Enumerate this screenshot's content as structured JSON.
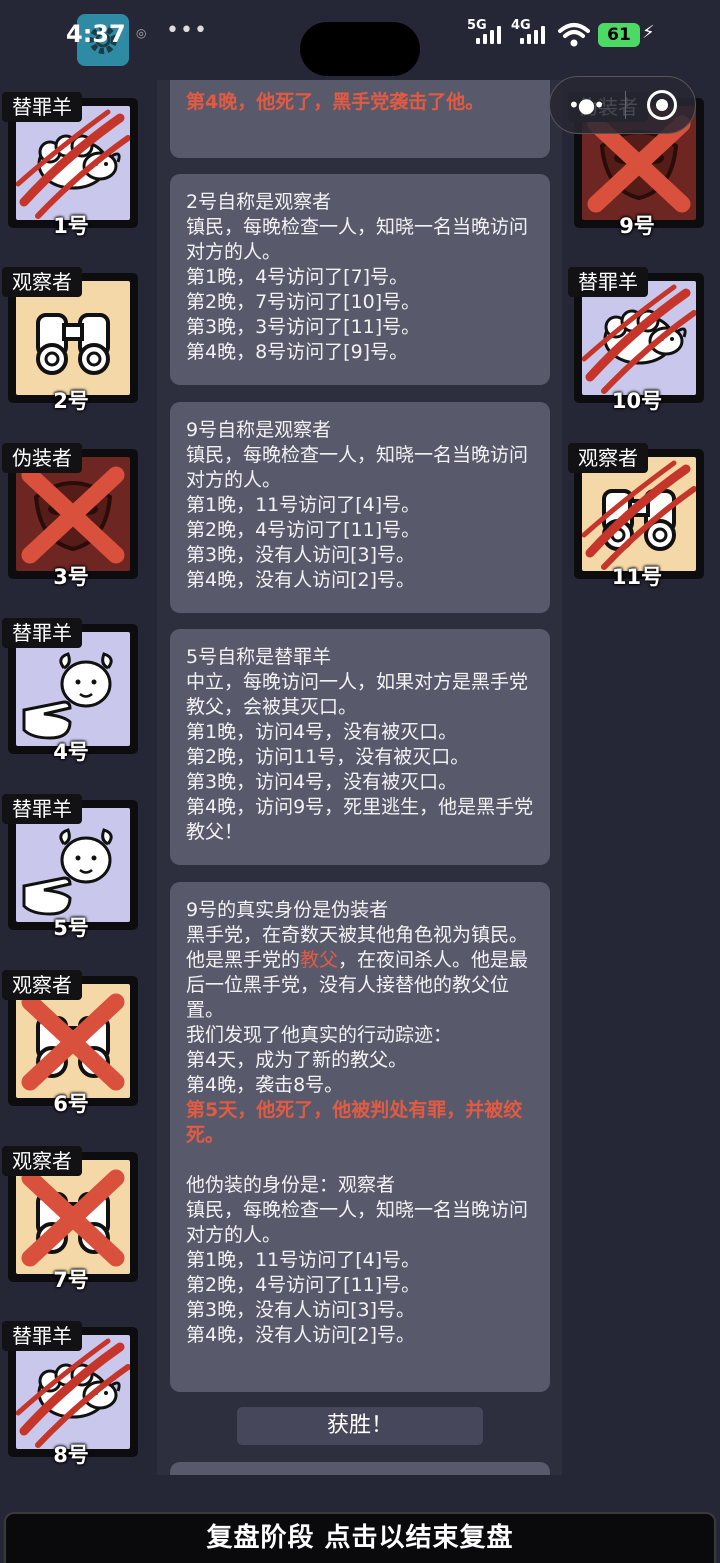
{
  "status_bar": {
    "time": "4:37",
    "more": "•••",
    "net1": "5G",
    "net2": "4G",
    "battery": "61"
  },
  "capsule": {
    "menu_icon": "dots-icon",
    "close_icon": "target-icon"
  },
  "colors": {
    "background": "#262736",
    "bubble": "#585a6c",
    "highlight": "#e25a41",
    "sheep_bg": "#c9c8ec",
    "watcher_bg": "#f4d8a8",
    "disguiser_bg": "#6e2622"
  },
  "left_cards": [
    {
      "role": "替罪羊",
      "num": "1号",
      "art": "sheep-icon",
      "state": "slashed"
    },
    {
      "role": "观察者",
      "num": "2号",
      "art": "binoculars-icon",
      "state": "alive"
    },
    {
      "role": "伪装者",
      "num": "3号",
      "art": "mask-icon",
      "state": "crossed"
    },
    {
      "role": "替罪羊",
      "num": "4号",
      "art": "sheep-pointing-icon",
      "state": "alive"
    },
    {
      "role": "替罪羊",
      "num": "5号",
      "art": "sheep-pointing-icon",
      "state": "alive"
    },
    {
      "role": "观察者",
      "num": "6号",
      "art": "binoculars-icon",
      "state": "crossed"
    },
    {
      "role": "观察者",
      "num": "7号",
      "art": "binoculars-icon",
      "state": "crossed"
    },
    {
      "role": "替罪羊",
      "num": "8号",
      "art": "sheep-icon",
      "state": "slashed"
    }
  ],
  "right_cards": [
    {
      "role": "伪装者",
      "num": "9号",
      "art": "mask-icon",
      "state": "crossed"
    },
    {
      "role": "替罪羊",
      "num": "10号",
      "art": "sheep-icon",
      "state": "slashed"
    },
    {
      "role": "观察者",
      "num": "11号",
      "art": "binoculars-icon",
      "state": "slashed"
    }
  ],
  "messages": {
    "m0": {
      "red": "第4晚，他死了，黑手党袭击了他。"
    },
    "m1": {
      "text": "2号自称是观察者\n镇民，每晚检查一人，知晓一名当晚访问对方的人。\n第1晚，4号访问了[7]号。\n第2晚，7号访问了[10]号。\n第3晚，3号访问了[11]号。\n第4晚，8号访问了[9]号。"
    },
    "m2": {
      "text": "9号自称是观察者\n镇民，每晚检查一人，知晓一名当晚访问对方的人。\n第1晚，11号访问了[4]号。\n第2晚，4号访问了[11]号。\n第3晚，没有人访问[3]号。\n第4晚，没有人访问[2]号。"
    },
    "m3": {
      "text": "5号自称是替罪羊\n中立，每晚访问一人，如果对方是黑手党教父，会被其灭口。\n第1晚，访问4号，没有被灭口。\n第2晚，访问11号，没有被灭口。\n第3晚，访问4号，没有被灭口。\n第4晚，访问9号，死里逃生，他是黑手党教父！"
    },
    "m4": {
      "part1": "9号的真实身份是伪装者\n黑手党，在奇数天被其他角色视为镇民。\n他是黑手党的",
      "kw": "教父",
      "part2": "，在夜间杀人。他是最后一位黑手党，没有人接替他的教父位置。\n我们发现了他真实的行动踪迹：\n第4天，成为了新的教父。\n第4晚，袭击8号。",
      "red": "第5天，他死了，他被判处有罪，并被绞死。",
      "part3": "\n他伪装的身份是：观察者\n镇民，每晚检查一人，知晓一名当晚访问对方的人。\n第1晚，11号访问了[4]号。\n第2晚，4号访问了[11]号。\n第3晚，没有人访问[3]号。\n第4晚，没有人访问[2]号。"
    }
  },
  "result": "获胜！",
  "footer": "复盘阶段 点击以结束复盘"
}
